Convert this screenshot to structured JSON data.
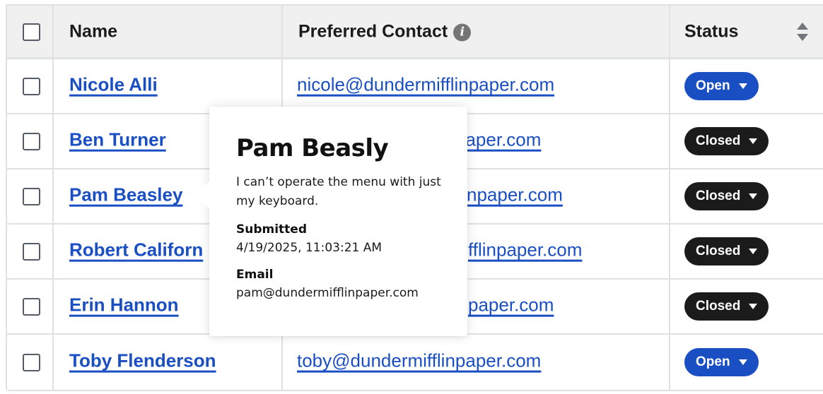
{
  "table": {
    "columns": {
      "name": "Name",
      "contact": "Preferred Contact",
      "status": "Status"
    },
    "rows": [
      {
        "name": "Nicole Alli",
        "email": "nicole@dundermifflinpaper.com",
        "status": "Open"
      },
      {
        "name": "Ben Turner",
        "email": "paper.com",
        "status": "Closed"
      },
      {
        "name": "Pam Beasley",
        "email": "npaper.com",
        "status": "Closed"
      },
      {
        "name": "Robert Californ",
        "email": "fflinpaper.com",
        "status": "Closed"
      },
      {
        "name": "Erin Hannon",
        "email": "paper.com",
        "status": "Closed"
      },
      {
        "name": "Toby Flenderson",
        "email": "toby@dundermifflinpaper.com",
        "status": "Open"
      }
    ]
  },
  "tooltip": {
    "title": "Pam Beasly",
    "message": "I can’t operate the menu with just my keyboard.",
    "submitted_label": "Submitted",
    "submitted_value": "4/19/2025, 11:03:21 AM",
    "email_label": "Email",
    "email_value": "pam@dundermifflinpaper.com"
  },
  "icons": {
    "info": "info-icon",
    "sort": "sort-icon",
    "caret": "caret-down-icon"
  },
  "colors": {
    "link": "#1a4fc4",
    "open_badge": "#1a4fc4",
    "closed_badge": "#1b1b1b",
    "header_bg": "#f0f0f0",
    "grid": "#dfe1e2"
  }
}
